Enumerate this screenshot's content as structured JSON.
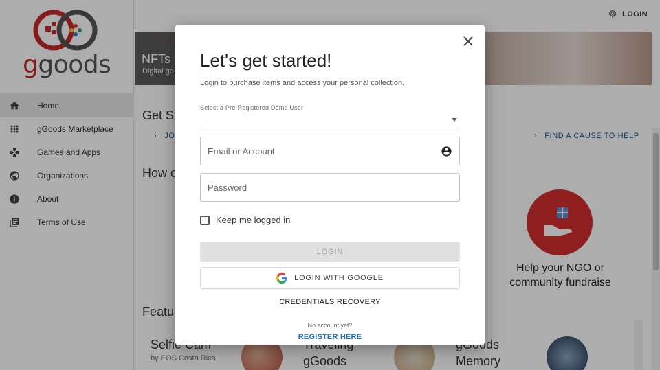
{
  "brand": {
    "logo_g": "g",
    "logo_rest": "goods",
    "colors": {
      "red": "#c62828",
      "grey": "#555555"
    }
  },
  "sidebar": {
    "items": [
      {
        "label": "Home",
        "icon": "home-icon",
        "active": true
      },
      {
        "label": "gGoods Marketplace",
        "icon": "grid-icon"
      },
      {
        "label": "Games and Apps",
        "icon": "gamepad-icon"
      },
      {
        "label": "Organizations",
        "icon": "globe-icon"
      },
      {
        "label": "About",
        "icon": "info-icon"
      },
      {
        "label": "Terms of Use",
        "icon": "document-icon"
      }
    ]
  },
  "topbar": {
    "login_label": "LOGIN"
  },
  "hero": {
    "title": "NFTs",
    "subtitle": "Digital go"
  },
  "main": {
    "get_started_heading": "Get St",
    "jo_link": "JO",
    "find_cause_link": "FIND A CAUSE TO HELP",
    "how_heading": "How c",
    "cause_text": "Help your NGO or community fundraise",
    "featured_heading": "Featu",
    "cards": [
      {
        "title": "Selfie Cam",
        "subtitle": "by EOS Costa Rica"
      },
      {
        "title": "Traveling gGoods"
      },
      {
        "title": "gGoods Memory"
      }
    ]
  },
  "modal": {
    "title": "Let's get started!",
    "subtitle": "Login to purchase items and access your personal collection.",
    "select_label": "Select a Pre-Registered Demo User",
    "email_placeholder": "Email or Account",
    "password_placeholder": "Password",
    "keep_logged_in": "Keep me logged in",
    "login_button": "LOGIN",
    "google_button": "LOGIN WITH GOOGLE",
    "credentials_recovery": "CREDENTIALS RECOVERY",
    "no_account": "No account yet?",
    "register": "REGISTER HERE"
  }
}
